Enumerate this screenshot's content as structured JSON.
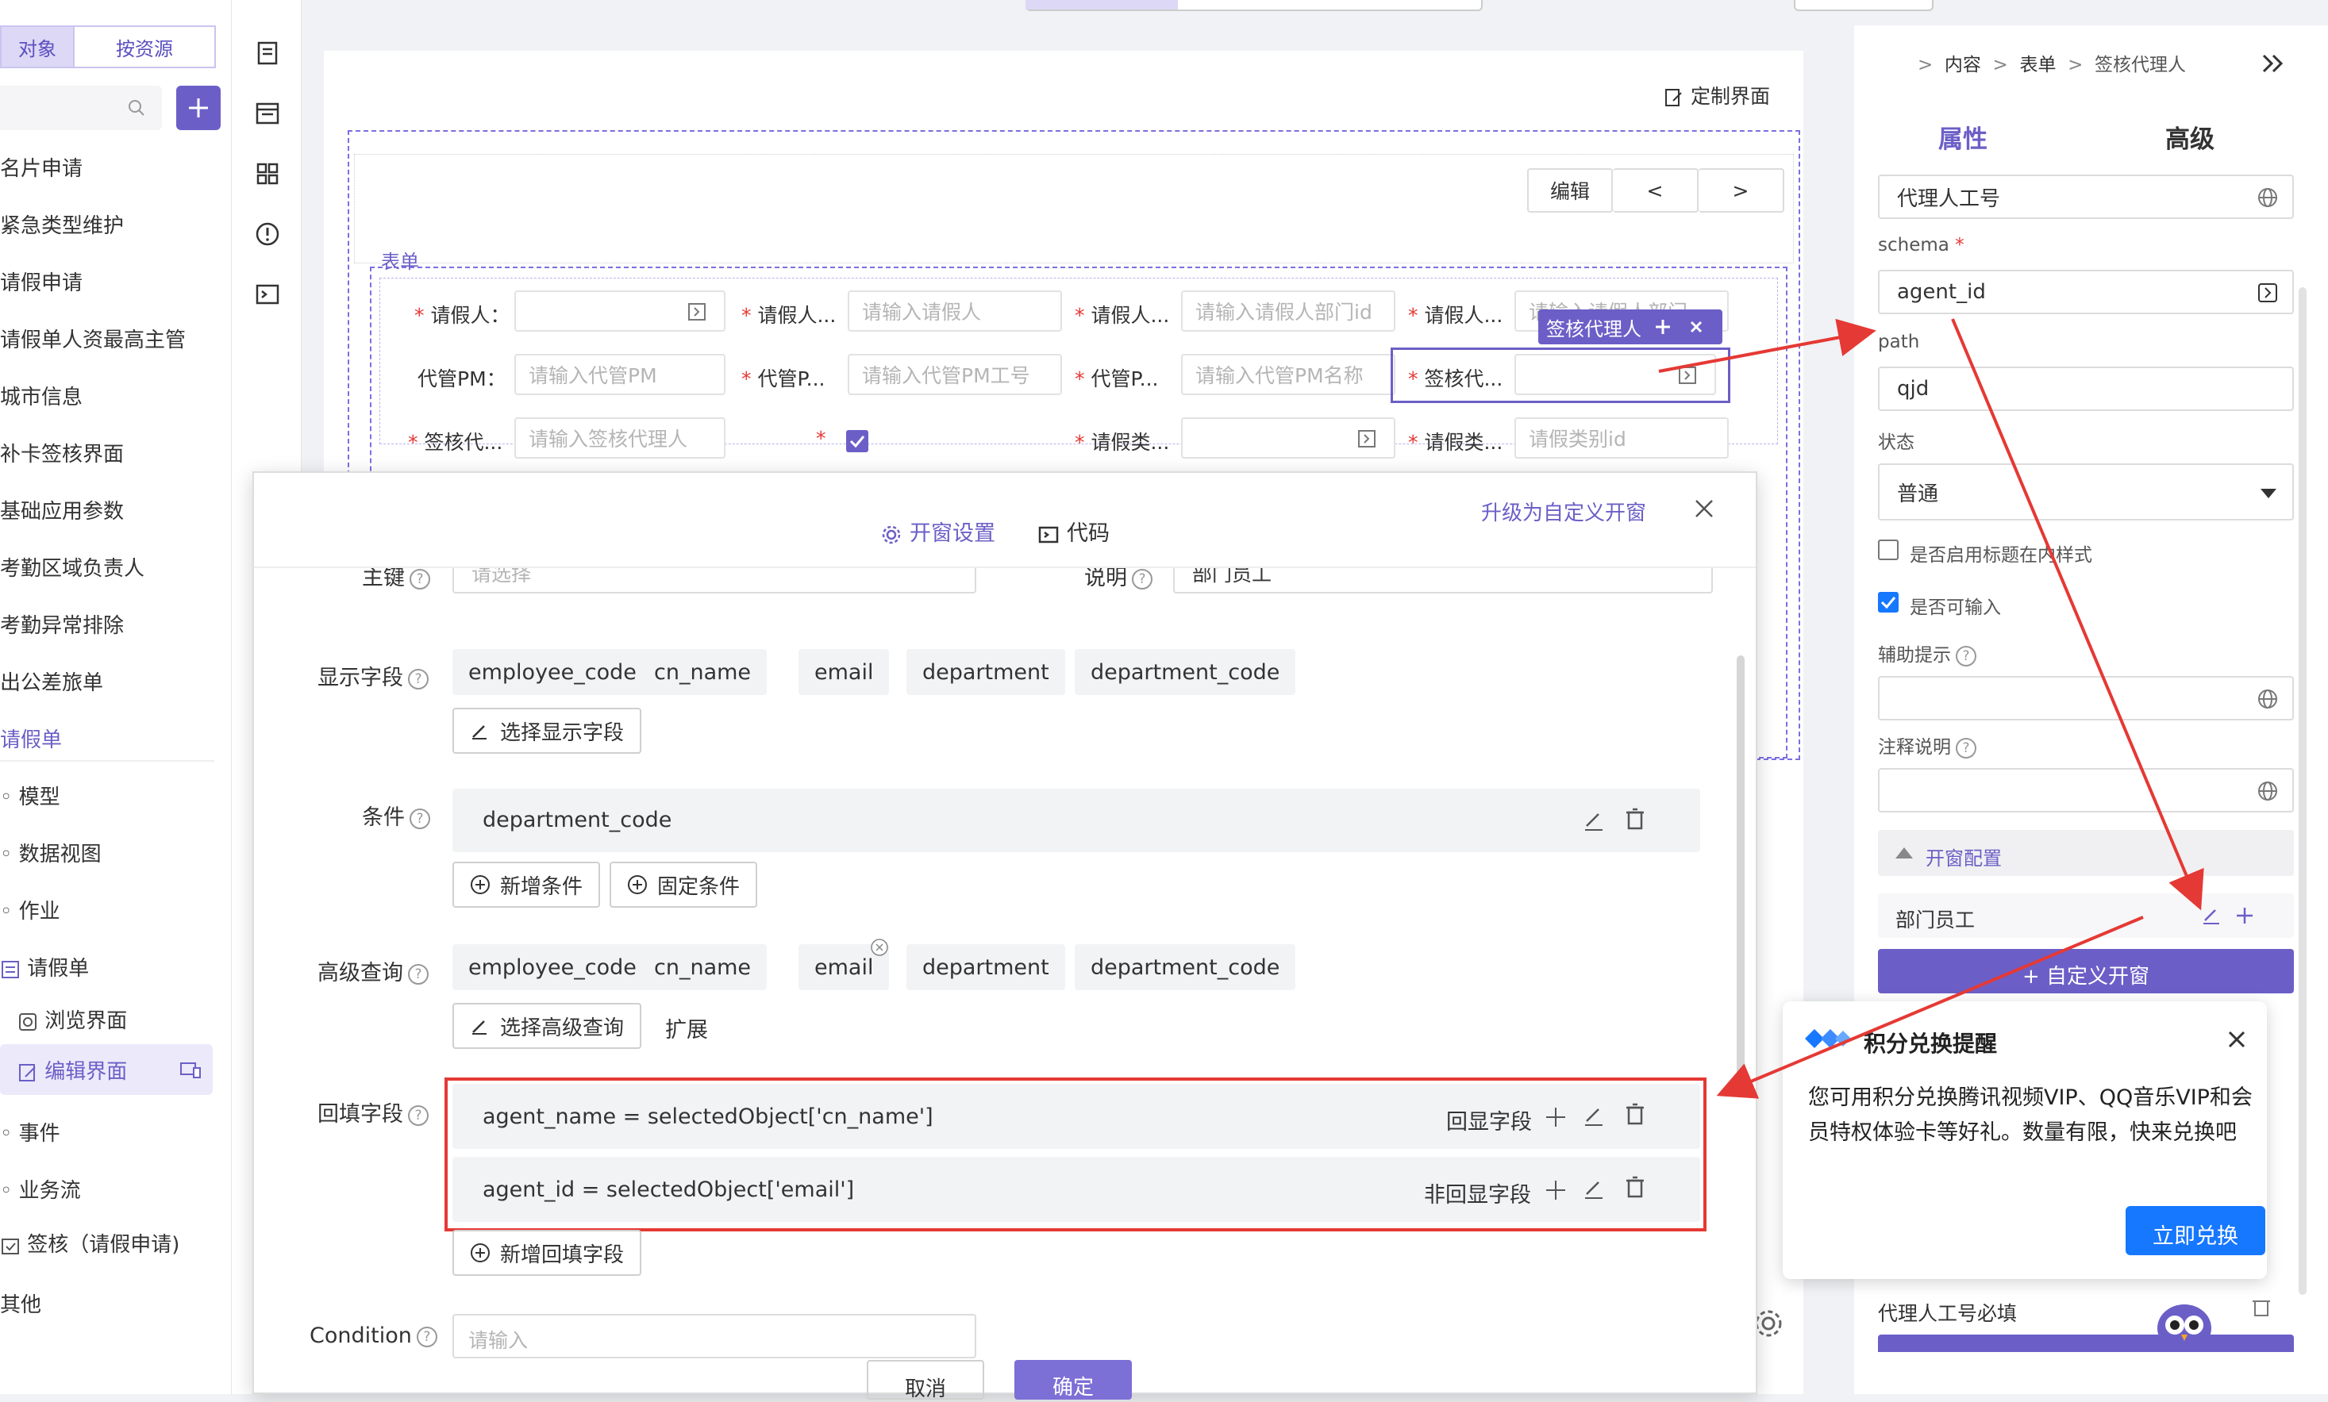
{
  "sidebar": {
    "seg_left": "对象",
    "seg_right": "按资源",
    "tree": [
      "名片申请",
      "紧急类型维护",
      "请假申请",
      "请假单人资最高主管",
      "城市信息",
      "补卡签核界面",
      "基础应用参数",
      "考勤区域负责人",
      "考勤异常排除",
      "出公差旅单",
      "请假单"
    ],
    "sub": {
      "model": "模型",
      "dataview": "数据视图",
      "job": "作业",
      "leave": "请假单",
      "browse": "浏览界面",
      "edit": "编辑界面",
      "event": "事件",
      "workflow": "业务流",
      "sign": "签核（请假申请)",
      "other": "其他"
    }
  },
  "canvas": {
    "customize": "定制界面",
    "edit_btn": "编辑",
    "prev_btn": "<",
    "next_btn": ">",
    "form_title": "表单",
    "tag_label": "签核代理人",
    "rows": [
      [
        {
          "label": "请假人：",
          "req": true,
          "ph": "",
          "icon": true
        },
        {
          "label": "请假人...",
          "req": true,
          "ph": "请输入请假人"
        },
        {
          "label": "请假人...",
          "req": true,
          "ph": "请输入请假人部门id"
        },
        {
          "label": "请假人...",
          "req": true,
          "ph": "请输入请假人部门"
        }
      ],
      [
        {
          "label": "代管PM：",
          "req": false,
          "ph": "请输入代管PM"
        },
        {
          "label": "代管P...",
          "req": true,
          "ph": "请输入代管PM工号"
        },
        {
          "label": "代管P...",
          "req": true,
          "ph": "请输入代管PM名称"
        },
        {
          "label": "签核代...",
          "req": true,
          "ph": "",
          "icon": true
        }
      ],
      [
        {
          "label": "签核代...",
          "req": true,
          "ph": "请输入签核代理人"
        },
        {
          "label": "",
          "req": true,
          "ph": "",
          "checkbox": true
        },
        {
          "label": "请假类...",
          "req": true,
          "ph": "",
          "icon": true
        },
        {
          "label": "请假类...",
          "req": true,
          "ph": "请假类别id"
        }
      ]
    ]
  },
  "modal": {
    "tab_settings": "开窗设置",
    "tab_code": "代码",
    "upgrade": "升级为自定义开窗",
    "primary_key_label": "主键",
    "primary_key_ph": "请选择",
    "desc_label": "说明",
    "desc_value": "部门员工",
    "display_label": "显示字段",
    "display_fields": [
      "employee_code",
      "cn_name",
      "email",
      "department",
      "department_code"
    ],
    "select_display": "选择显示字段",
    "condition_label": "条件",
    "condition_value": "department_code",
    "add_condition": "新增条件",
    "fixed_condition": "固定条件",
    "adv_label": "高级查询",
    "adv_fields": [
      "employee_code",
      "cn_name",
      "email",
      "department",
      "department_code"
    ],
    "select_adv": "选择高级查询",
    "extend": "扩展",
    "backfill_label": "回填字段",
    "backfill": [
      {
        "expr": "agent_name = selectedObject['cn_name']",
        "tag": "回显字段"
      },
      {
        "expr": "agent_id = selectedObject['email']",
        "tag": "非回显字段"
      }
    ],
    "add_backfill": "新增回填字段",
    "condition2_label": "Condition",
    "condition2_ph": "请输入",
    "cancel": "取消",
    "confirm": "确定"
  },
  "right": {
    "breadcrumb": [
      "内容",
      "表单",
      "签核代理人"
    ],
    "tab_props": "属性",
    "tab_adv": "高级",
    "title_value": "代理人工号",
    "schema_label": "schema",
    "schema_value": "agent_id",
    "path_label": "path",
    "path_value": "qjd",
    "state_label": "状态",
    "state_value": "普通",
    "cb1": "是否启用标题在内样式",
    "cb2": "是否可输入",
    "hint_label": "辅助提示",
    "note_label": "注释说明",
    "popup_section": "开窗配置",
    "popup_item": "部门员工",
    "custom_btn": "+ 自定义开窗",
    "required_item": "代理人工号必填"
  },
  "notify": {
    "title": "积分兑换提醒",
    "body": "您可用积分兑换腾讯视频VIP、QQ音乐VIP和会员特权体验卡等好礼。数量有限，快来兑换吧",
    "action": "立即兑换"
  },
  "colors": {
    "accent": "#6b5fc7",
    "highlight": "#e53935",
    "primary_btn": "#7c6fd6",
    "blue_btn": "#1677ff"
  }
}
